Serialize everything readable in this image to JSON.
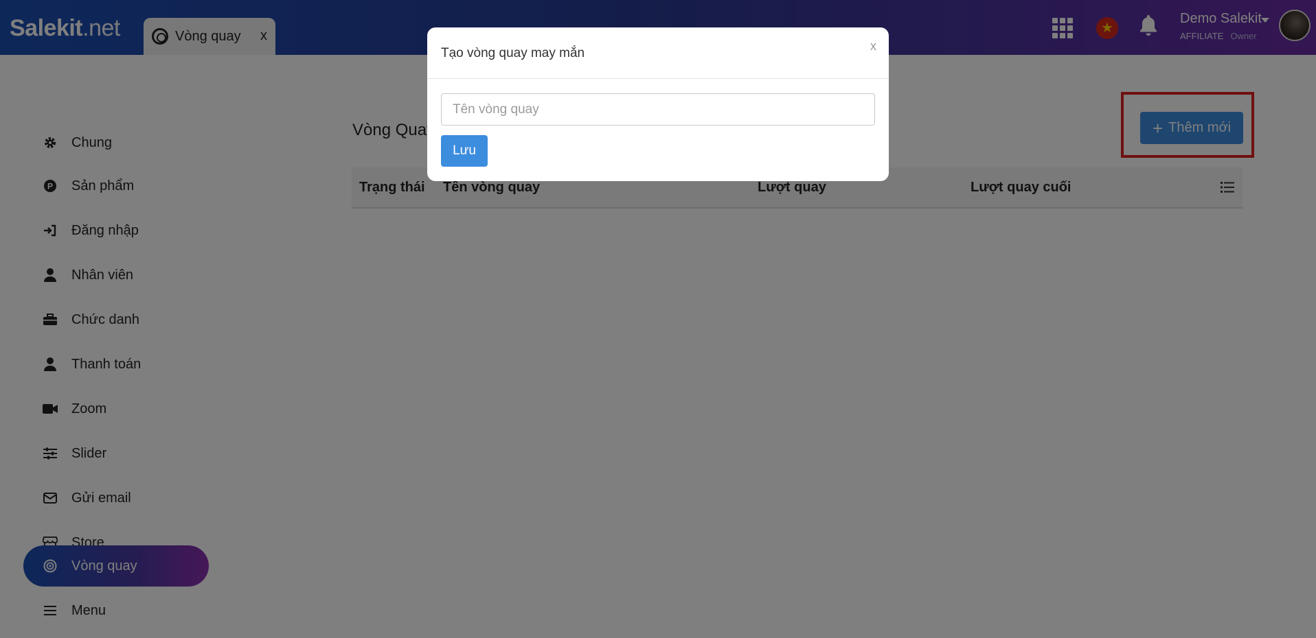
{
  "header": {
    "logo_main": "Salekit",
    "logo_suffix": ".net",
    "tab": {
      "label": "Vòng quay",
      "close": "x"
    },
    "user": {
      "name": "Demo Salekit",
      "role": "AFFILIATE",
      "subrole": "Owner"
    }
  },
  "sidebar": {
    "items": [
      {
        "label": "Chung",
        "icon": "gear-icon"
      },
      {
        "label": "Sản phẩm",
        "icon": "product-icon"
      },
      {
        "label": "Đăng nhập",
        "icon": "login-icon"
      },
      {
        "label": "Nhân viên",
        "icon": "user-icon"
      },
      {
        "label": "Chức danh",
        "icon": "briefcase-icon"
      },
      {
        "label": "Thanh toán",
        "icon": "user-icon"
      },
      {
        "label": "Zoom",
        "icon": "video-icon"
      },
      {
        "label": "Slider",
        "icon": "sliders-icon"
      },
      {
        "label": "Gửi email",
        "icon": "envelope-icon"
      },
      {
        "label": "Store",
        "icon": "store-icon"
      },
      {
        "label": "Vòng quay",
        "icon": "wheel-icon",
        "active": true
      },
      {
        "label": "Menu",
        "icon": "menu-icon"
      }
    ]
  },
  "main": {
    "title": "Vòng Quay",
    "add_button": "Thêm mới",
    "table": {
      "columns": [
        "Trạng thái",
        "Tên vòng quay",
        "Lượt quay",
        "Lượt quay cuối"
      ]
    }
  },
  "modal": {
    "title": "Tạo vòng quay may mắn",
    "close": "x",
    "input_placeholder": "Tên vòng quay",
    "save_label": "Lưu"
  }
}
